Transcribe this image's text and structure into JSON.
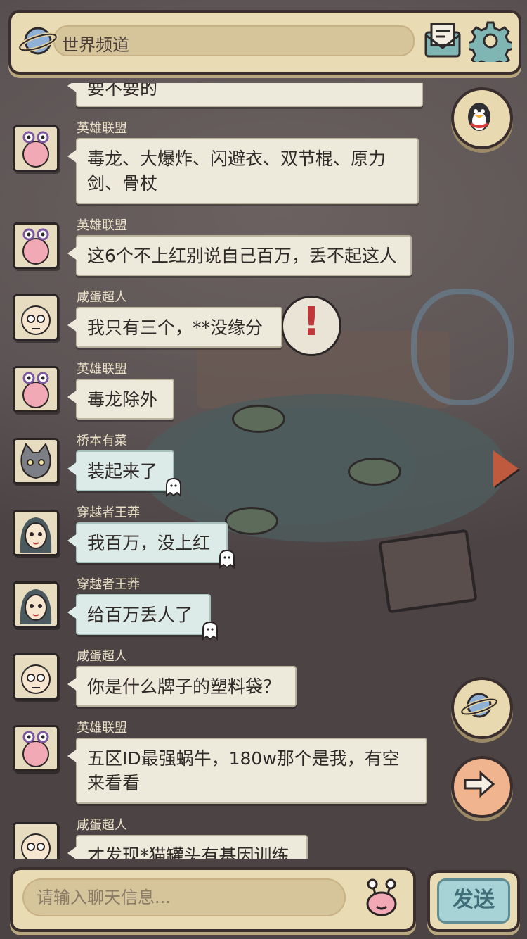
{
  "header": {
    "channel_title": "世界频道",
    "planet_icon": "planet-icon",
    "mail_icon": "mail-icon",
    "settings_icon": "gear-icon"
  },
  "messages": [
    {
      "name": "",
      "text": "要不要的",
      "style": "plain"
    },
    {
      "name": "英雄联盟",
      "text": "毒龙、大爆炸、闪避衣、双节棍、原力剑、骨杖",
      "style": "plain",
      "avatar": "snail"
    },
    {
      "name": "英雄联盟",
      "text": "这6个不上红别说自己百万，丢不起这人",
      "style": "plain",
      "avatar": "snail"
    },
    {
      "name": "咸蛋超人",
      "text": "我只有三个，**没缘分",
      "style": "plain",
      "avatar": "boy"
    },
    {
      "name": "英雄联盟",
      "text": "毒龙除外",
      "style": "plain",
      "avatar": "snail"
    },
    {
      "name": "桥本有菜",
      "text": "装起来了",
      "style": "blue",
      "avatar": "cat"
    },
    {
      "name": "穿越者王莽",
      "text": "我百万，没上红",
      "style": "blue",
      "avatar": "girl"
    },
    {
      "name": "穿越者王莽",
      "text": "给百万丢人了",
      "style": "blue",
      "avatar": "girl"
    },
    {
      "name": "咸蛋超人",
      "text": "你是什么牌子的塑料袋？",
      "style": "plain",
      "avatar": "boy"
    },
    {
      "name": "英雄联盟",
      "text": "五区ID最强蜗牛，180w那个是我，有空来看看",
      "style": "plain",
      "avatar": "snail"
    },
    {
      "name": "咸蛋超人",
      "text": "才发现*猫罐头有基因训练",
      "style": "plain",
      "avatar": "boy"
    }
  ],
  "side_buttons": {
    "qq_icon": "penguin-icon",
    "world_icon": "planet-icon",
    "next_icon": "arrow-right-icon"
  },
  "input": {
    "placeholder": "请输入聊天信息..."
  },
  "send_label": "发送"
}
